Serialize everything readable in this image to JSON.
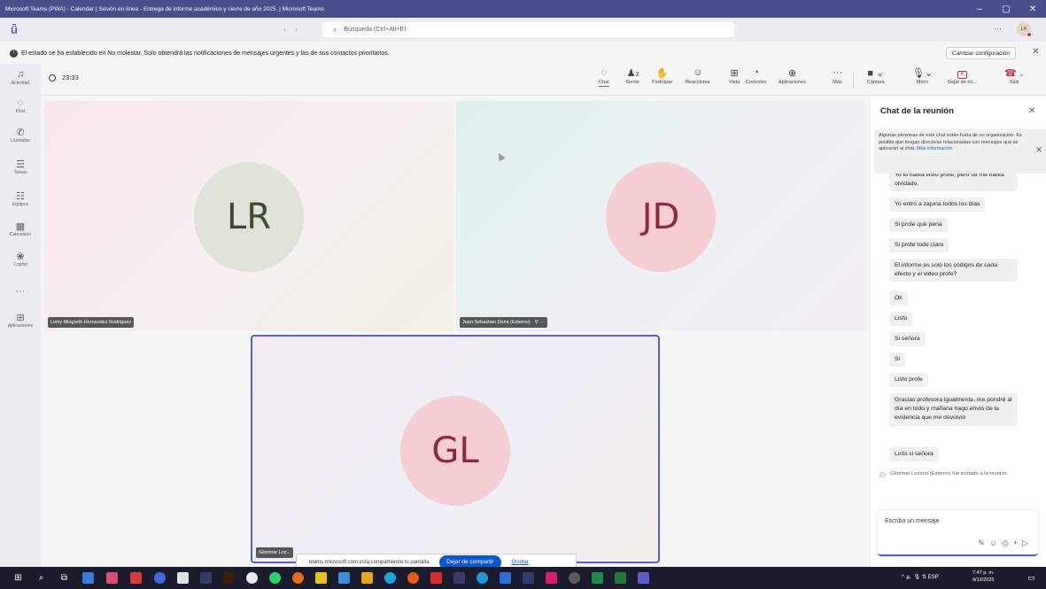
{
  "window": {
    "title": "Microsoft Teams (PWA) - Calendar | Sesión en línea - Entrega de informe académico y cierre de año 2025. | Microsoft Teams"
  },
  "search": {
    "placeholder": "Búsqueda (Ctrl+Alt+E)"
  },
  "user": {
    "initials": "LR"
  },
  "banner": {
    "text": "El estado se ha establecido en No molestar. Solo obtendrá las notificaciones de mensajes urgentes y las de sus contactos prioritarios.",
    "button": "Cambiar configuración"
  },
  "rail": [
    {
      "label": "Actividad",
      "icon": "bell-icon"
    },
    {
      "label": "Chat",
      "icon": "chat-icon"
    },
    {
      "label": "Llamadas",
      "icon": "phone-icon"
    },
    {
      "label": "Tareas",
      "icon": "tasks-icon"
    },
    {
      "label": "Equipos",
      "icon": "teams-icon"
    },
    {
      "label": "Calendario",
      "icon": "calendar-icon"
    },
    {
      "label": "Copilot",
      "icon": "copilot-icon"
    },
    {
      "label": "Aplicaciones",
      "icon": "apps-icon"
    }
  ],
  "meeting": {
    "timer": "23:33",
    "tools": {
      "chat": "Chat",
      "people": "Gente",
      "people_count": "3",
      "raise": "Participar",
      "react": "Reaccionar",
      "view": "Vista",
      "controls": "Controles",
      "apps": "Aplicaciones",
      "more": "Más",
      "camera": "Cámara",
      "mic": "Micro",
      "stop_share": "Dejar de co...",
      "leave": "Salir"
    }
  },
  "participants": [
    {
      "initials": "LR",
      "name": "Leiny Mingreth Hernandez Rodriguez"
    },
    {
      "initials": "JD",
      "name": "Juan Sebastian Doria (Externo)"
    },
    {
      "initials": "GL",
      "name": "Glorimar Loz..."
    }
  ],
  "share_notice": {
    "text": "teams.microsoft.com está compartiendo tu pantalla.",
    "stop_button": "Dejar de compartir",
    "hide_link": "Ocultar"
  },
  "chat": {
    "title": "Chat de la reunión",
    "notice": "Algunas personas de este chat están fuera de su organización. Es posible que tengan directivas relacionadas con mensajes que se aplicarán al chat.",
    "notice_link": "Más información",
    "messages": [
      "Yo lo había visto profe, pero se me había olvidado.",
      "Yo entro a zajuna todos los días",
      "Si profe que pena",
      "Si profe todo claro",
      "El informe es solo los códigos de cada efecto y el video profe?",
      "Ok",
      "Listo",
      "Si señora",
      "Si",
      "Listo profe",
      "Gracias profesora igualmente, me pondré al día en todo y mañana hago envío de la evidencia que me devolvió",
      "Listo si señora"
    ],
    "system_message": "Glorimar Lozano (Externo) fue invitado a la reunión.",
    "composer_placeholder": "Escriba un mensaje"
  },
  "taskbar": {
    "language": "ESP",
    "time": "7:47 p. m.",
    "date": "9/12/2025"
  }
}
